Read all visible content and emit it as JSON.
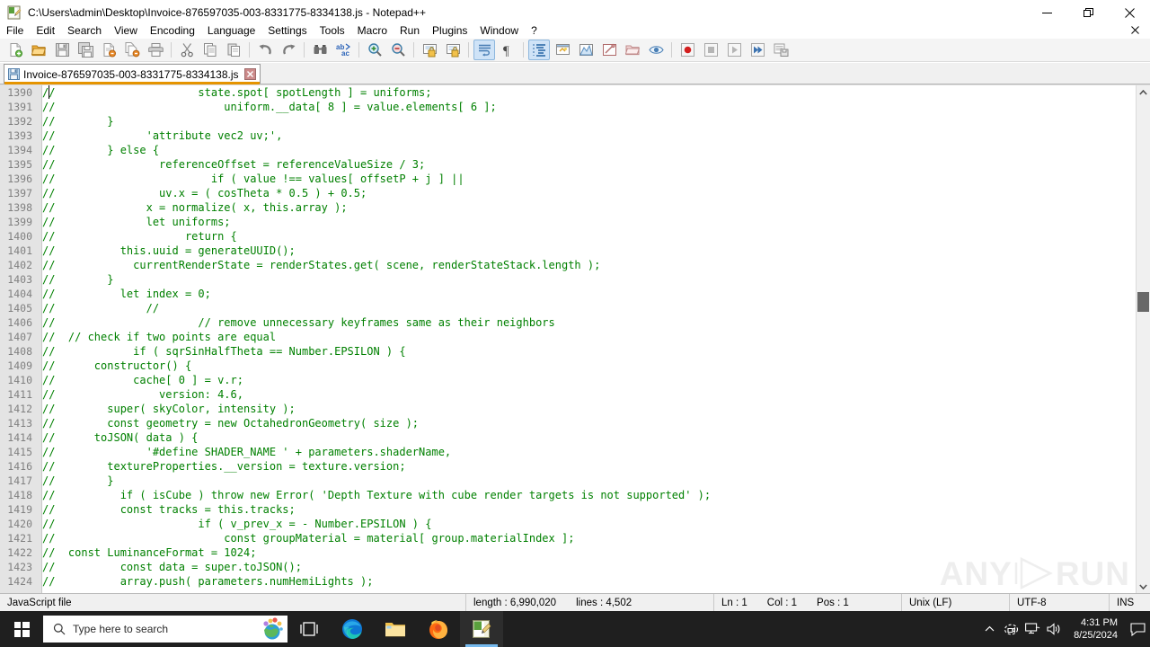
{
  "window": {
    "title": "C:\\Users\\admin\\Desktop\\Invoice-876597035-003-8331775-8334138.js - Notepad++",
    "minimize_label": "─",
    "maximize_label": "❐",
    "close_label": "✕"
  },
  "menu": {
    "items": [
      "File",
      "Edit",
      "Search",
      "View",
      "Encoding",
      "Language",
      "Settings",
      "Tools",
      "Macro",
      "Run",
      "Plugins",
      "Window",
      "?"
    ],
    "doc_close_label": "✕"
  },
  "toolbar": {
    "buttons": [
      {
        "name": "new-file",
        "label": "New"
      },
      {
        "name": "open-file",
        "label": "Open"
      },
      {
        "name": "save-file",
        "label": "Save"
      },
      {
        "name": "save-all",
        "label": "Save All"
      },
      {
        "name": "close-file",
        "label": "Close"
      },
      {
        "name": "close-all",
        "label": "Close All"
      },
      {
        "name": "print",
        "label": "Print"
      },
      {
        "name": "cut",
        "label": "Cut"
      },
      {
        "name": "copy",
        "label": "Copy"
      },
      {
        "name": "paste",
        "label": "Paste"
      },
      {
        "name": "undo",
        "label": "Undo"
      },
      {
        "name": "redo",
        "label": "Redo"
      },
      {
        "name": "find",
        "label": "Find"
      },
      {
        "name": "replace",
        "label": "Replace"
      },
      {
        "name": "zoom-in",
        "label": "Zoom In"
      },
      {
        "name": "zoom-out",
        "label": "Zoom Out"
      },
      {
        "name": "sync-vertical-scroll",
        "label": "Synchronize Vertical Scrolling"
      },
      {
        "name": "sync-horizontal-scroll",
        "label": "Synchronize Horizontal Scrolling"
      },
      {
        "name": "word-wrap",
        "label": "Word wrap"
      },
      {
        "name": "show-all-characters",
        "label": "Show All Characters"
      },
      {
        "name": "show-indent-guide",
        "label": "Show Indent Guide"
      },
      {
        "name": "user-defined-dialog",
        "label": "UserDefine Dialogue"
      },
      {
        "name": "document-map",
        "label": "Document Map"
      },
      {
        "name": "function-list",
        "label": "Function List"
      },
      {
        "name": "folder-as-workspace",
        "label": "Folder as Workspace"
      },
      {
        "name": "monitoring",
        "label": "Monitoring"
      },
      {
        "name": "macro-record",
        "label": "Start Recording"
      },
      {
        "name": "macro-stop",
        "label": "Stop Recording"
      },
      {
        "name": "macro-play",
        "label": "Playback"
      },
      {
        "name": "macro-run-multiple",
        "label": "Run a Macro Multiple Times"
      },
      {
        "name": "macro-save",
        "label": "Save Current Recorded Macro"
      }
    ]
  },
  "tab": {
    "label": "Invoice-876597035-003-8331775-8334138.js",
    "close_label": "✕"
  },
  "editor": {
    "first_line_number": 1390,
    "lines": [
      "//                      state.spot[ spotLength ] = uniforms;",
      "//                          uniform.__data[ 8 ] = value.elements[ 6 ];",
      "//        }",
      "//              'attribute vec2 uv;',",
      "//        } else {",
      "//                referenceOffset = referenceValueSize / 3;",
      "//                        if ( value !== values[ offsetP + j ] ||",
      "//                uv.x = ( cosTheta * 0.5 ) + 0.5;",
      "//              x = normalize( x, this.array );",
      "//              let uniforms;",
      "//                    return {",
      "//          this.uuid = generateUUID();",
      "//            currentRenderState = renderStates.get( scene, renderStateStack.length );",
      "//        }",
      "//          let index = 0;",
      "//              //",
      "//                      // remove unnecessary keyframes same as their neighbors",
      "//  // check if two points are equal",
      "//            if ( sqrSinHalfTheta == Number.EPSILON ) {",
      "//      constructor() {",
      "//            cache[ 0 ] = v.r;",
      "//                version: 4.6,",
      "//        super( skyColor, intensity );",
      "//        const geometry = new OctahedronGeometry( size );",
      "//      toJSON( data ) {",
      "//              '#define SHADER_NAME ' + parameters.shaderName,",
      "//        textureProperties.__version = texture.version;",
      "//        }",
      "//          if ( isCube ) throw new Error( 'Depth Texture with cube render targets is not supported' );",
      "//          const tracks = this.tracks;",
      "//                      if ( v_prev_x = - Number.EPSILON ) {",
      "//                          const groupMaterial = material[ group.materialIndex ];",
      "//  const LuminanceFormat = 1024;",
      "//          const data = super.toJSON();",
      "//          array.push( parameters.numHemiLights );"
    ],
    "comment_color": "#008000",
    "scroll_up_label": "∧",
    "scroll_down_label": "∨"
  },
  "watermark": {
    "left_text": "ANY",
    "right_text": "RUN"
  },
  "status": {
    "file_type": "JavaScript file",
    "length_label": "length : 6,990,020",
    "lines_label": "lines : 4,502",
    "ln": "Ln : 1",
    "col": "Col : 1",
    "pos": "Pos : 1",
    "eol": "Unix (LF)",
    "encoding": "UTF-8",
    "insert_mode": "INS"
  },
  "taskbar": {
    "search_placeholder": "Type here to search",
    "items": [
      {
        "name": "task-view",
        "label": "Task View"
      },
      {
        "name": "microsoft-edge",
        "label": "Microsoft Edge"
      },
      {
        "name": "file-explorer",
        "label": "File Explorer"
      },
      {
        "name": "mozilla-firefox",
        "label": "Mozilla Firefox"
      },
      {
        "name": "notepad-plus-plus",
        "label": "Notepad++"
      }
    ],
    "time": "4:31 PM",
    "date": "8/25/2024",
    "tray_overflow_label": "∧"
  }
}
